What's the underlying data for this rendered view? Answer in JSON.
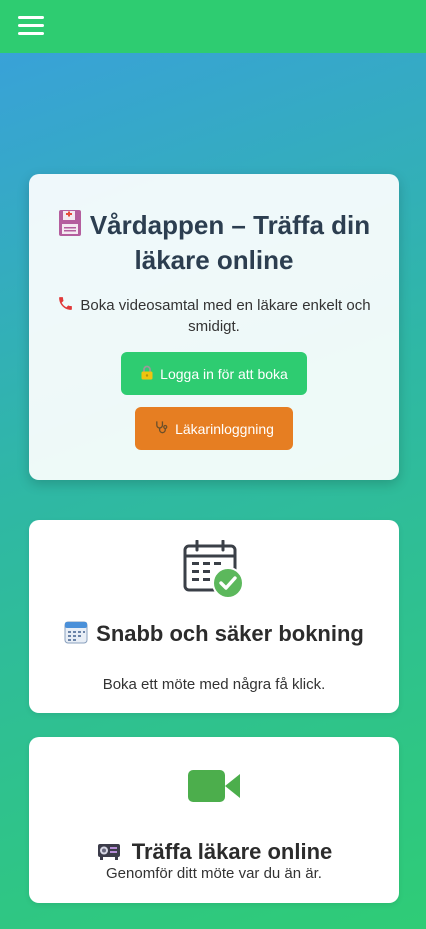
{
  "header": {
    "menu_icon": "hamburger-icon",
    "color": "#2ecc71"
  },
  "hero": {
    "title_icon": "floppy-disk-icon",
    "title": "Vårdappen – Träffa din läkare online",
    "description_icon": "telephone-icon",
    "description": "Boka videosamtal med en läkare enkelt och smidigt.",
    "login_button": {
      "icon": "lock-icon",
      "label": "Logga in för att boka",
      "color": "#2ecc71"
    },
    "doctor_button": {
      "icon": "stethoscope-icon",
      "label": "Läkarinloggning",
      "color": "#e67e22"
    }
  },
  "features": [
    {
      "image_icon": "calendar-check-icon",
      "title_icon": "calendar-icon",
      "title": "Snabb och säker bokning",
      "description": "Boka ett möte med några få klick."
    },
    {
      "image_icon": "video-camera-icon",
      "title_icon": "video-projector-icon",
      "title": "Träffa läkare online",
      "description": "Genomför ditt möte var du än är."
    }
  ]
}
